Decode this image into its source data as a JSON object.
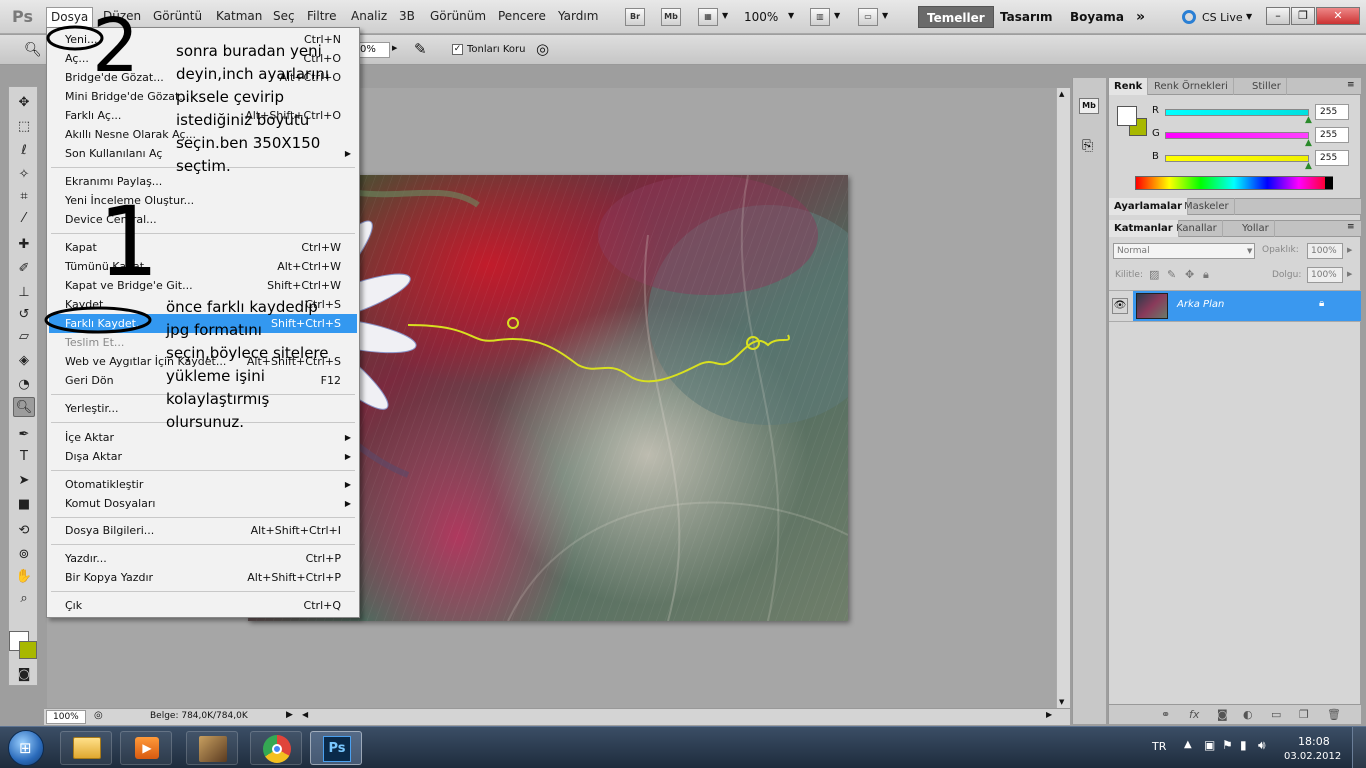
{
  "menubar": {
    "logo": "Ps",
    "items": [
      "Dosya",
      "Düzen",
      "Görüntü",
      "Katman",
      "Seç",
      "Filtre",
      "Analiz",
      "3B",
      "Görünüm",
      "Pencere",
      "Yardım"
    ],
    "br": "Br",
    "mb": "Mb",
    "zoom": "100%",
    "workspaces": [
      "Temeller",
      "Tasarım",
      "Boyama"
    ],
    "more": "»",
    "cslive": "CS Live"
  },
  "optbar": {
    "opacity": "0%",
    "tonlari_koru": "Tonları Koru"
  },
  "filemenu": {
    "groups": [
      [
        {
          "label": "Yeni...",
          "shortcut": "Ctrl+N"
        },
        {
          "label": "Aç...",
          "shortcut": "Ctrl+O"
        },
        {
          "label": "Bridge'de Gözat...",
          "shortcut": "Alt+Ctrl+O"
        },
        {
          "label": "Mini Bridge'de Gözat...",
          "shortcut": ""
        },
        {
          "label": "Farklı Aç...",
          "shortcut": "Alt+Shift+Ctrl+O"
        },
        {
          "label": "Akıllı Nesne Olarak Aç...",
          "shortcut": ""
        },
        {
          "label": "Son Kullanılanı Aç",
          "shortcut": "",
          "submenu": true
        }
      ],
      [
        {
          "label": "Ekranımı Paylaş...",
          "shortcut": ""
        },
        {
          "label": "Yeni İnceleme Oluştur...",
          "shortcut": ""
        },
        {
          "label": "Device Central...",
          "shortcut": ""
        }
      ],
      [
        {
          "label": "Kapat",
          "shortcut": "Ctrl+W"
        },
        {
          "label": "Tümünü Kapat",
          "shortcut": "Alt+Ctrl+W"
        },
        {
          "label": "Kapat ve Bridge'e Git...",
          "shortcut": "Shift+Ctrl+W"
        },
        {
          "label": "Kaydet",
          "shortcut": "Ctrl+S"
        },
        {
          "label": "Farklı Kaydet...",
          "shortcut": "Shift+Ctrl+S",
          "highlight": true
        },
        {
          "label": "Teslim Et...",
          "shortcut": "",
          "disabled": true
        },
        {
          "label": "Web ve Aygıtlar İçin Kaydet...",
          "shortcut": "Alt+Shift+Ctrl+S"
        },
        {
          "label": "Geri Dön",
          "shortcut": "F12"
        }
      ],
      [
        {
          "label": "Yerleştir...",
          "shortcut": ""
        }
      ],
      [
        {
          "label": "İçe Aktar",
          "shortcut": "",
          "submenu": true
        },
        {
          "label": "Dışa Aktar",
          "shortcut": "",
          "submenu": true
        }
      ],
      [
        {
          "label": "Otomatikleştir",
          "shortcut": "",
          "submenu": true
        },
        {
          "label": "Komut Dosyaları",
          "shortcut": "",
          "submenu": true
        }
      ],
      [
        {
          "label": "Dosya Bilgileri...",
          "shortcut": "Alt+Shift+Ctrl+I"
        }
      ],
      [
        {
          "label": "Yazdır...",
          "shortcut": "Ctrl+P"
        },
        {
          "label": "Bir Kopya Yazdır",
          "shortcut": "Alt+Shift+Ctrl+P"
        }
      ],
      [
        {
          "label": "Çık",
          "shortcut": "Ctrl+Q"
        }
      ]
    ]
  },
  "annotations": {
    "num2": "2",
    "num1": "1",
    "note_top": [
      "sonra buradan yeni",
      "deyin,inch ayarlarını",
      "piksele çevirip",
      "istediğiniz boyutu",
      "seçin.ben 350X150",
      "seçtim."
    ],
    "note_bottom": [
      "önce farklı kaydedip",
      "jpg formatını",
      "seçin,böylece sitelere",
      "yükleme işini",
      "kolaylaştırmış",
      "olursunuz."
    ]
  },
  "color_panel": {
    "tabs": [
      "Renk",
      "Renk Örnekleri",
      "Stiller"
    ],
    "channels": [
      {
        "label": "R",
        "value": "255",
        "color": "#00e0e0"
      },
      {
        "label": "G",
        "value": "255",
        "color": "#ff20ff"
      },
      {
        "label": "B",
        "value": "255",
        "color": "#f0f000"
      }
    ],
    "bg_swatch": "#a8b800"
  },
  "adjust_panel": {
    "tabs": [
      "Ayarlamalar",
      "Maskeler"
    ]
  },
  "layers_panel": {
    "tabs": [
      "Katmanlar",
      "Kanallar",
      "Yollar"
    ],
    "blend_mode": "Normal",
    "opacity_label": "Opaklık:",
    "opacity": "100%",
    "lock_label": "Kilitle:",
    "fill_label": "Dolgu:",
    "fill": "100%",
    "layer_name": "Arka Plan"
  },
  "statusbar": {
    "zoom": "100%",
    "doc": "Belge: 784,0K/784,0K"
  },
  "tray": {
    "lang": "TR",
    "time": "18:08",
    "date": "03.02.2012"
  }
}
